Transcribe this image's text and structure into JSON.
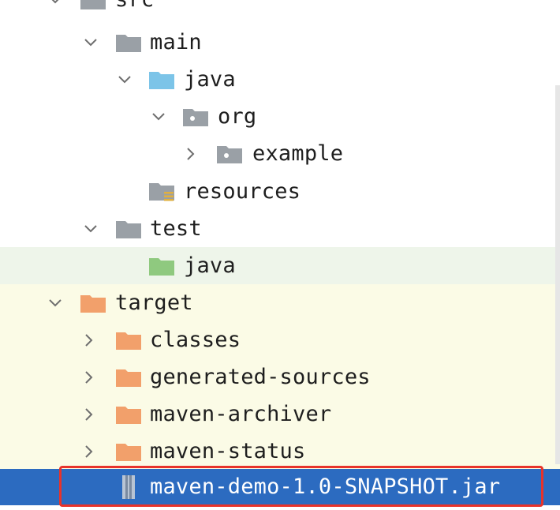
{
  "tree": {
    "rows": [
      {
        "label": "src",
        "icon": "folder-gray",
        "chevron": "down"
      },
      {
        "label": "main",
        "icon": "folder-gray",
        "chevron": "down"
      },
      {
        "label": "java",
        "icon": "folder-blue-source",
        "chevron": "down"
      },
      {
        "label": "org",
        "icon": "package",
        "chevron": "down"
      },
      {
        "label": "example",
        "icon": "package",
        "chevron": "right"
      },
      {
        "label": "resources",
        "icon": "folder-resources",
        "chevron": "none"
      },
      {
        "label": "test",
        "icon": "folder-gray",
        "chevron": "down"
      },
      {
        "label": "java",
        "icon": "folder-green-test",
        "chevron": "none"
      },
      {
        "label": "target",
        "icon": "folder-orange",
        "chevron": "down"
      },
      {
        "label": "classes",
        "icon": "folder-orange",
        "chevron": "right"
      },
      {
        "label": "generated-sources",
        "icon": "folder-orange",
        "chevron": "right"
      },
      {
        "label": "maven-archiver",
        "icon": "folder-orange",
        "chevron": "right"
      },
      {
        "label": "maven-status",
        "icon": "folder-orange",
        "chevron": "right"
      },
      {
        "label": "maven-demo-1.0-SNAPSHOT.jar",
        "icon": "jar-file",
        "chevron": "none",
        "selected": true
      }
    ]
  },
  "colors": {
    "selection": "#2c6bc0",
    "highlight_box": "#e8332b",
    "excluded_bg": "#fbfbe6",
    "test_bg": "#eef5ea",
    "folder_gray": "#9aa0a6",
    "folder_blue": "#7cc4e8",
    "folder_green": "#8fc97f",
    "folder_orange": "#f2a06b"
  }
}
